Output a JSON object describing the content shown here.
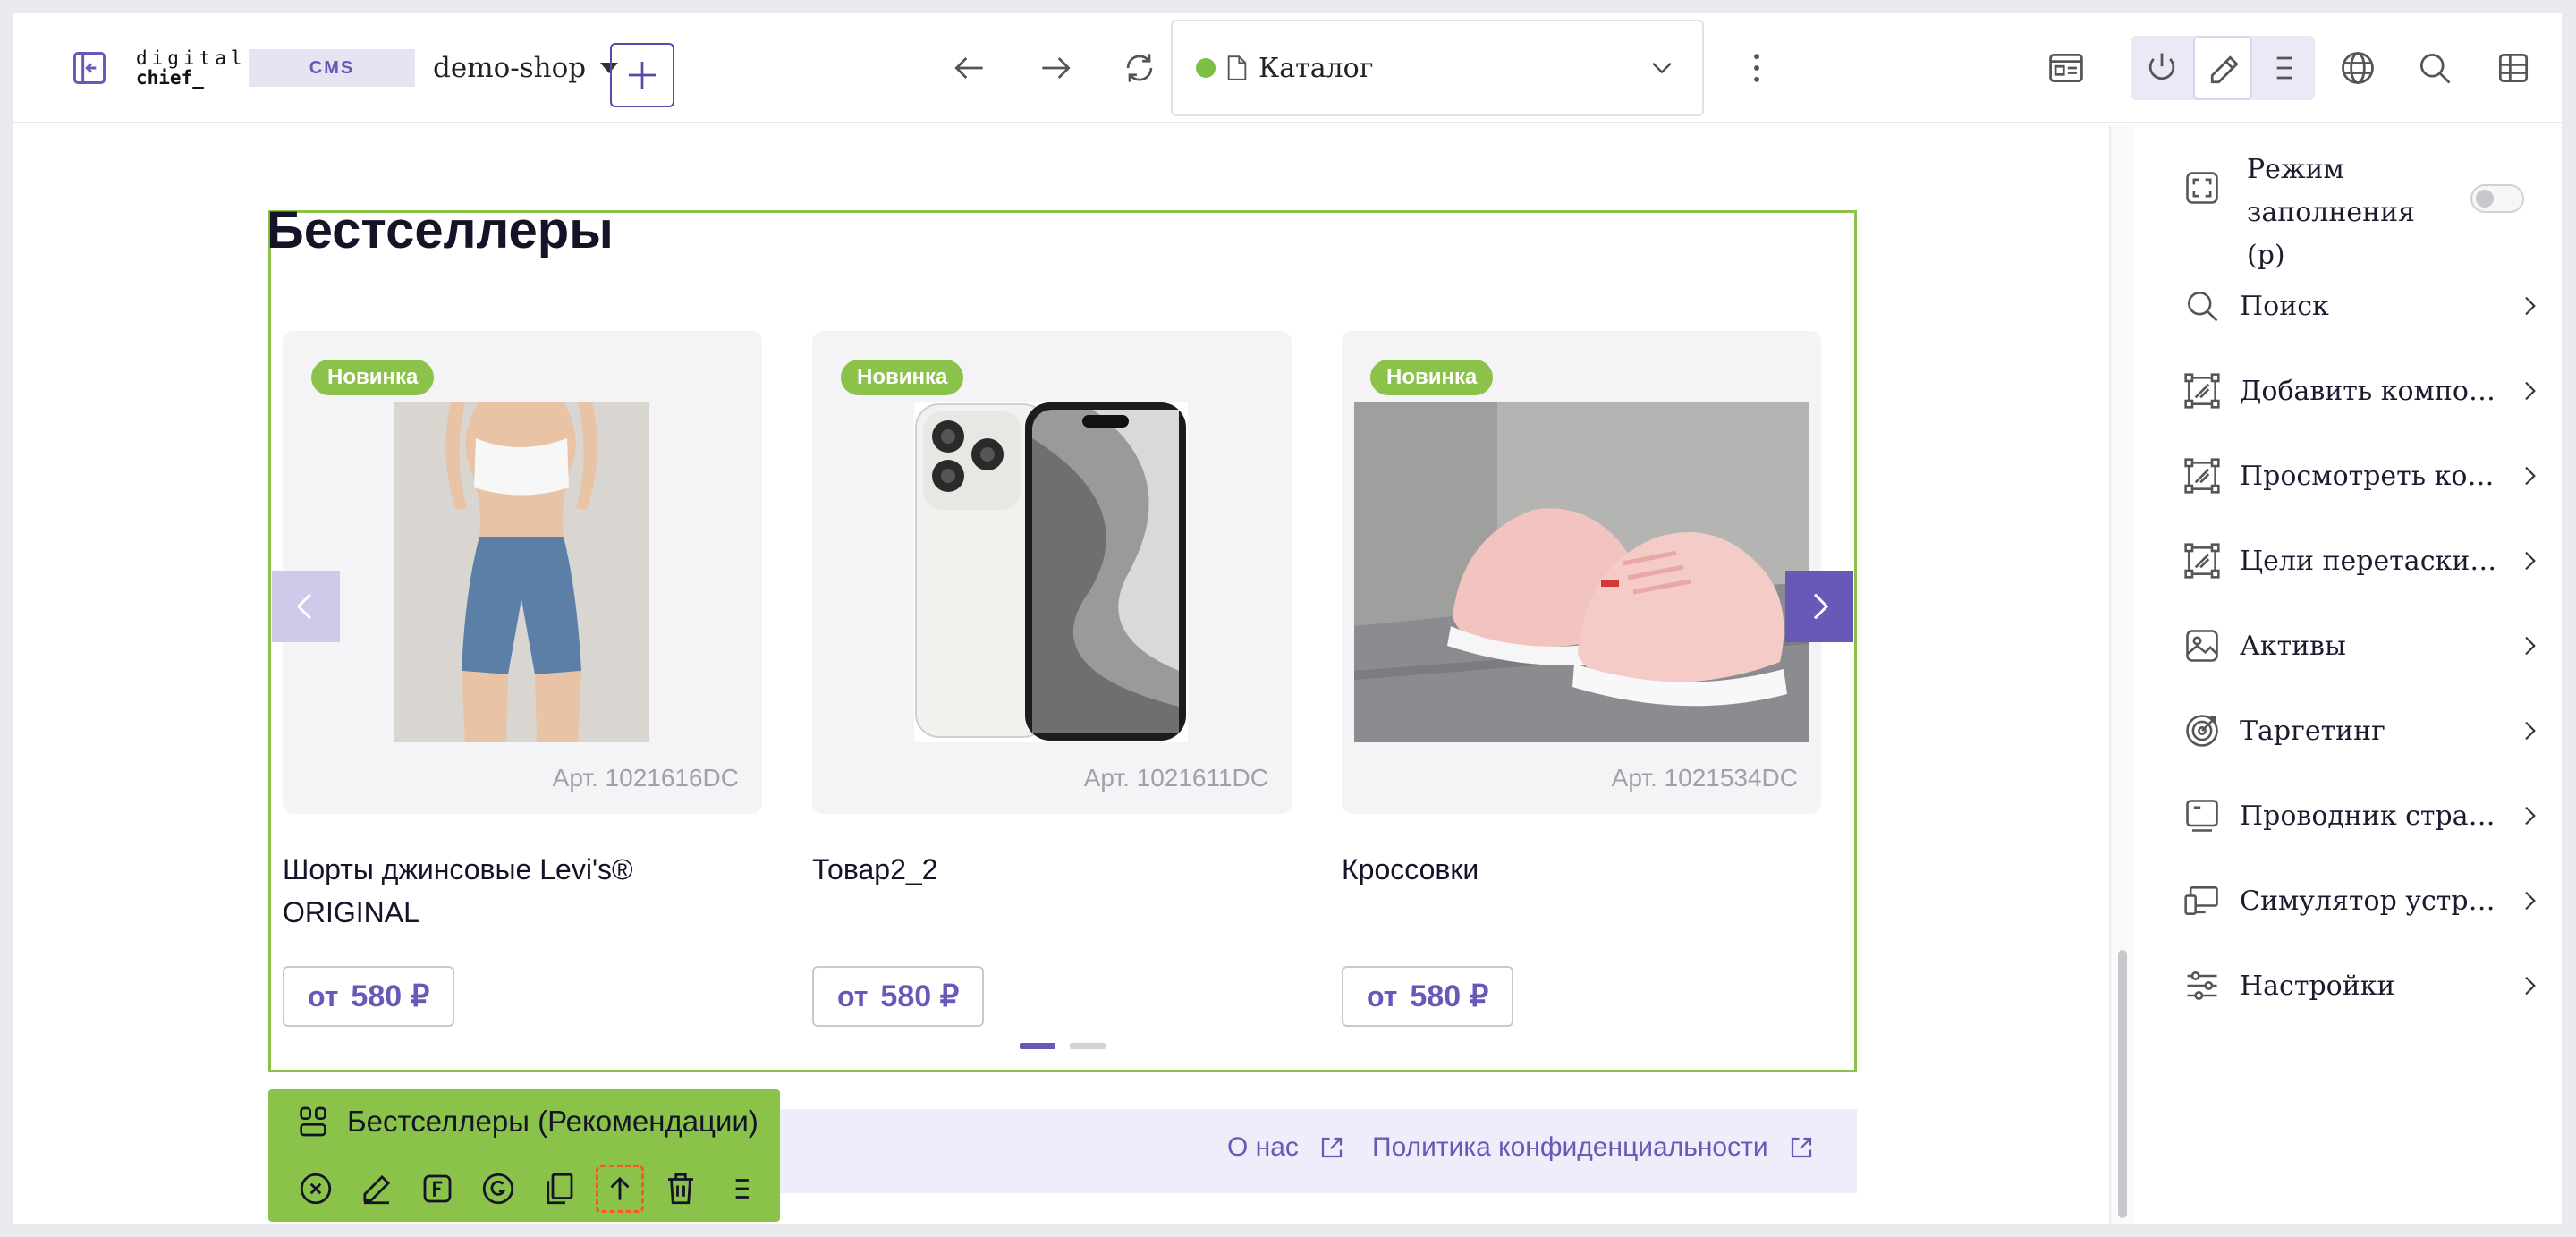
{
  "topbar": {
    "logo_line1": "digital",
    "logo_line2": "chief_",
    "cms_label": "CMS",
    "site": "demo-shop",
    "url_page": "Каталог",
    "url_status_color": "#7bc043"
  },
  "section": {
    "title": "Бестселлеры",
    "badge_color": "#8bc34a",
    "accent": "#6a58b8"
  },
  "products": [
    {
      "badge": "Новинка",
      "article": "Арт. 1021616DC",
      "name": "Шорты джинсовые Levi's® ORIGINAL",
      "price_prefix": "от",
      "price": "580 ₽"
    },
    {
      "badge": "Новинка",
      "article": "Арт. 1021611DC",
      "name": "Товар2_2",
      "price_prefix": "от",
      "price": "580 ₽"
    },
    {
      "badge": "Новинка",
      "article": "Арт. 1021534DC",
      "name": "Кроссовки",
      "price_prefix": "от",
      "price": "580 ₽"
    }
  ],
  "carousel": {
    "pages": 2,
    "active_page": 1
  },
  "footer": {
    "about": "О нас",
    "privacy": "Политика конфиденциальности"
  },
  "component_toolbar": {
    "title": "Бестселлеры (Рекомендации)",
    "buttons": [
      "close-icon",
      "edit-icon",
      "f-icon",
      "g-icon",
      "copy-icon",
      "select-parent-icon",
      "trash-icon",
      "menu-icon"
    ]
  },
  "panel": {
    "fill_mode": "Режим заполнения (p)",
    "fill_mode_on": false,
    "items": [
      {
        "label": "Поиск",
        "icon": "search-icon"
      },
      {
        "label": "Добавить компоненты",
        "icon": "component-add-icon"
      },
      {
        "label": "Просмотреть компоненты",
        "icon": "component-view-icon"
      },
      {
        "label": "Цели перетаскивания",
        "icon": "drop-target-icon"
      },
      {
        "label": "Активы",
        "icon": "image-icon"
      },
      {
        "label": "Таргетинг",
        "icon": "target-icon"
      },
      {
        "label": "Проводник страниц",
        "icon": "pages-icon"
      },
      {
        "label": "Симулятор устройств",
        "icon": "devices-icon"
      },
      {
        "label": "Настройки",
        "icon": "settings-icon"
      }
    ]
  }
}
